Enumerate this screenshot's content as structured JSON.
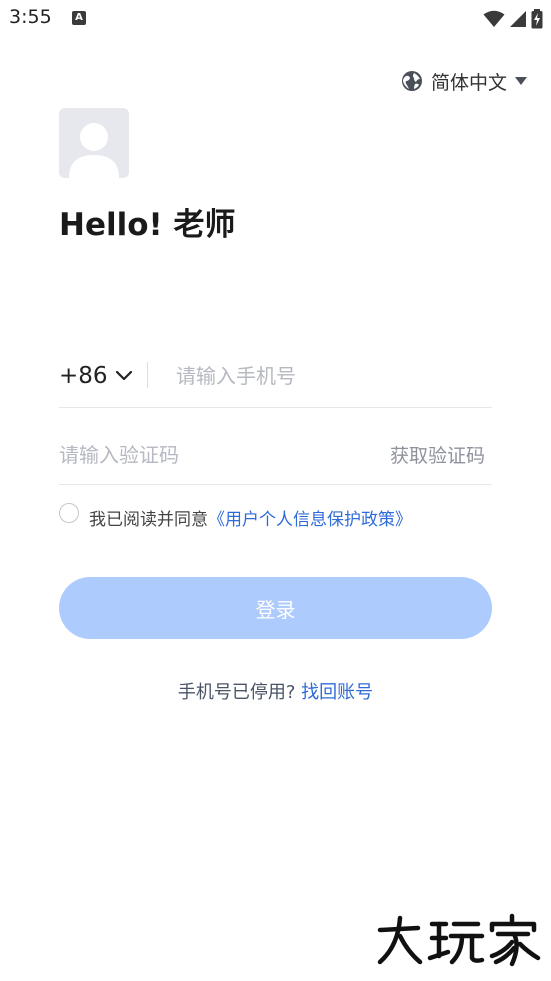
{
  "status_bar": {
    "time": "3:55",
    "app_badge": "A",
    "icons": [
      "wifi-icon",
      "signal-icon",
      "battery-charging-icon"
    ]
  },
  "language": {
    "label": "简体中文",
    "icon": "globe-icon"
  },
  "greeting": "Hello! 老师",
  "phone": {
    "country_code": "+86",
    "placeholder": "请输入手机号",
    "value": ""
  },
  "code": {
    "placeholder": "请输入验证码",
    "value": "",
    "get_code_label": "获取验证码"
  },
  "agreement": {
    "checked": false,
    "text": "我已阅读并同意",
    "link": "《用户个人信息保护政策》"
  },
  "login_button": "登录",
  "footer": {
    "text": "手机号已停用?",
    "link": "找回账号"
  },
  "watermark": "大玩家",
  "colors": {
    "primary": "#2f6bd8",
    "button_disabled": "#aecbfd",
    "placeholder": "#b6b9c2"
  }
}
